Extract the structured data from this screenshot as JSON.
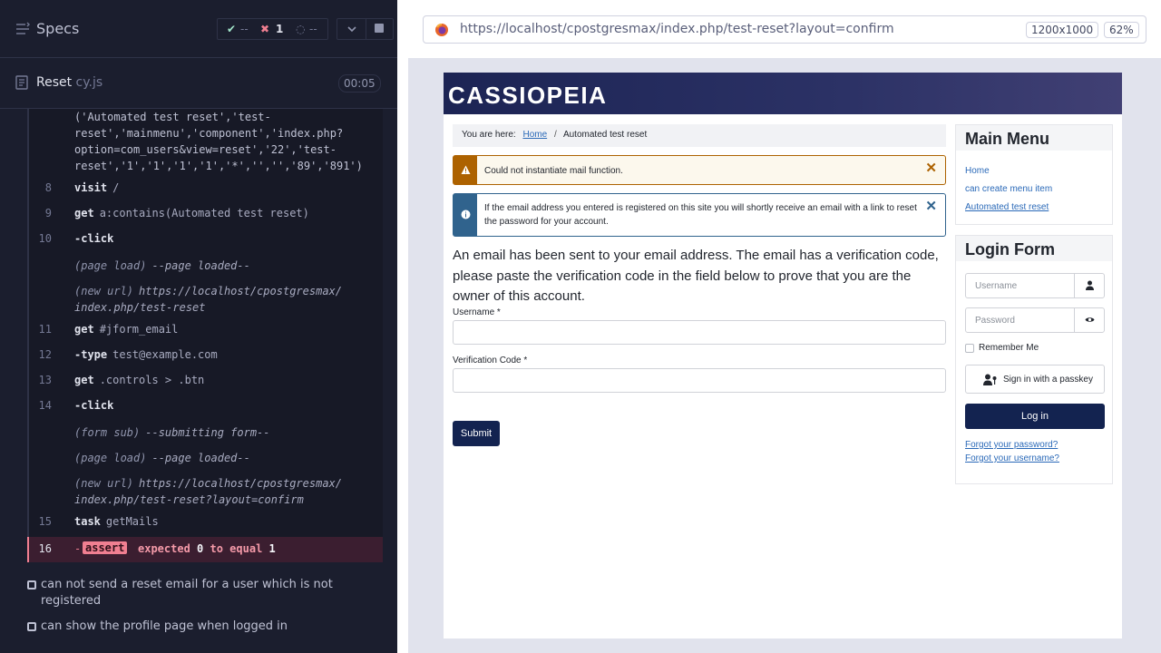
{
  "reporter": {
    "title": "Specs",
    "stats": {
      "pass_icon": "✔",
      "passed": "--",
      "fail_icon": "✖",
      "failed": "1",
      "pending_icon": "◌",
      "pending": "--"
    },
    "spec": {
      "name": "Reset",
      "ext": " cy.js",
      "duration": "00:05"
    },
    "wrap_text": "('Automated test reset','test-\nreset','mainmenu','component','index.php?\noption=com_users&view=reset','22','test-\nreset','1','1','1','1','*','','','89','891')",
    "commands": [
      {
        "num": "8",
        "name": "visit",
        "arg": "/"
      },
      {
        "num": "9",
        "name": "get",
        "arg": "a:contains(Automated test reset)"
      },
      {
        "num": "10",
        "name": "-click",
        "arg": ""
      },
      {
        "num": "",
        "sub": "(page load)",
        "em": "--page loaded--"
      },
      {
        "num": "",
        "sub": "(new url)",
        "em": "https://localhost/cpostgresmax/",
        "em2": "index.php/test-reset"
      },
      {
        "num": "11",
        "name": "get",
        "arg": "#jform_email"
      },
      {
        "num": "12",
        "name": "-type",
        "arg": "test@example.com"
      },
      {
        "num": "13",
        "name": "get",
        "arg": ".controls > .btn"
      },
      {
        "num": "14",
        "name": "-click",
        "arg": ""
      },
      {
        "num": "",
        "sub": "(form sub)",
        "em": "--submitting form--"
      },
      {
        "num": "",
        "sub": "(page load)",
        "em": "--page loaded--"
      },
      {
        "num": "",
        "sub": "(new url)",
        "em": "https://localhost/cpostgresmax/",
        "em2": "index.php/test-reset?layout=confirm"
      },
      {
        "num": "15",
        "name": "task",
        "arg": "getMails"
      }
    ],
    "assert": {
      "num": "16",
      "dash": "-",
      "badge": "assert",
      "pre": "expected ",
      "expected": "0",
      "mid": " to equal ",
      "actual": "1"
    },
    "tests": [
      {
        "label": "can not send a reset email for a user which is not registered"
      },
      {
        "label": "can show the profile page when logged in"
      }
    ]
  },
  "browser": {
    "url": "https://localhost/cpostgresmax/index.php/test-reset?layout=confirm",
    "viewport": "1200x1000",
    "zoom": "62%"
  },
  "site": {
    "brand": "CASSIOPEIA",
    "breadcrumb": {
      "prefix": "You are here:",
      "home": "Home",
      "sep": "/",
      "current": "Automated test reset"
    },
    "alerts": {
      "warning": "Could not instantiate mail function.",
      "info": "If the email address you entered is registered on this site you will shortly receive an email with a link to reset the password for your account.",
      "close": "✕"
    },
    "intro": "An email has been sent to your email address. The email has a verification code, please paste the verification code in the field below to prove that you are the owner of this account.",
    "form": {
      "username_label": "Username *",
      "code_label": "Verification Code *",
      "submit": "Submit"
    },
    "main_menu": {
      "title": "Main Menu",
      "items": [
        "Home",
        "can create menu item",
        "Automated test reset"
      ]
    },
    "login": {
      "title": "Login Form",
      "username_placeholder": "Username",
      "password_placeholder": "Password",
      "remember": "Remember Me",
      "passkey": "Sign in with a passkey",
      "login_button": "Log in",
      "forgot_password": "Forgot your password?",
      "forgot_username": "Forgot your username?"
    }
  }
}
